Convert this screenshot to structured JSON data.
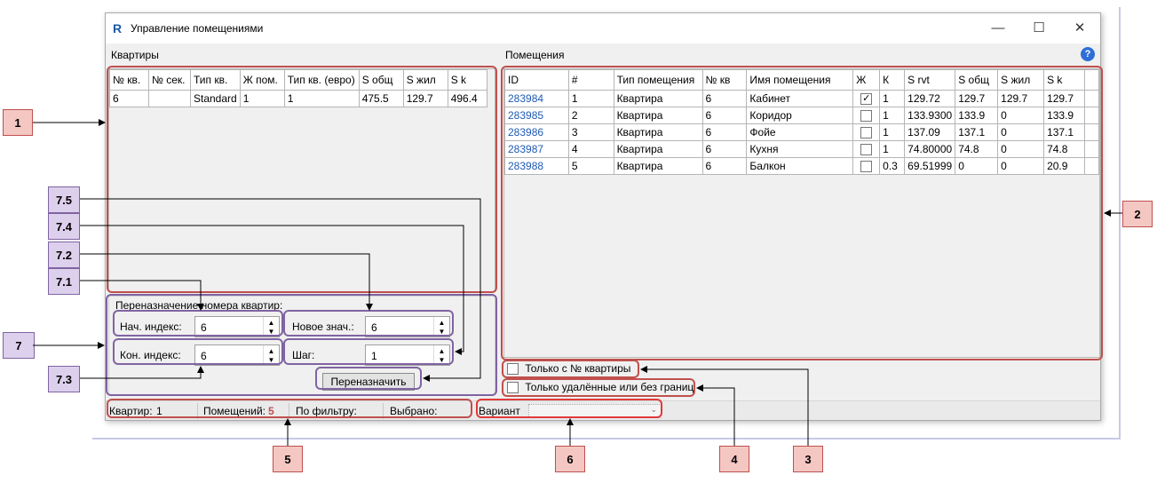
{
  "window": {
    "app_icon": "R",
    "title": "Управление помещениями",
    "controls": [
      "—",
      "☐",
      "✕"
    ]
  },
  "apartments": {
    "label": "Квартиры",
    "columns": [
      "№ кв.",
      "№ сек.",
      "Тип кв.",
      "Ж пом.",
      "Тип кв. (евро)",
      "S общ",
      "S жил",
      "S k"
    ],
    "rows": [
      [
        "6",
        "",
        "Standard",
        "1",
        "1",
        "475.5",
        "129.7",
        "496.4"
      ]
    ]
  },
  "rooms": {
    "label": "Помещения",
    "help_icon": "?",
    "columns": [
      "ID",
      "#",
      "Тип помещения",
      "№ кв",
      "Имя помещения",
      "Ж",
      "К",
      "S rvt",
      "S общ",
      "S жил",
      "S k"
    ],
    "rows": [
      {
        "id": "283984",
        "n": "1",
        "type": "Квартира",
        "apt": "6",
        "name": "Кабинет",
        "zh": true,
        "k": "1",
        "srvt": "129.72",
        "sobsh": "129.7",
        "szhil": "129.7",
        "sk": "129.7"
      },
      {
        "id": "283985",
        "n": "2",
        "type": "Квартира",
        "apt": "6",
        "name": "Коридор",
        "zh": false,
        "k": "1",
        "srvt": "133.9300",
        "sobsh": "133.9",
        "szhil": "0",
        "sk": "133.9"
      },
      {
        "id": "283986",
        "n": "3",
        "type": "Квартира",
        "apt": "6",
        "name": "Фойе",
        "zh": false,
        "k": "1",
        "srvt": "137.09",
        "sobsh": "137.1",
        "szhil": "0",
        "sk": "137.1"
      },
      {
        "id": "283987",
        "n": "4",
        "type": "Квартира",
        "apt": "6",
        "name": "Кухня",
        "zh": false,
        "k": "1",
        "srvt": "74.80000",
        "sobsh": "74.8",
        "szhil": "0",
        "sk": "74.8"
      },
      {
        "id": "283988",
        "n": "5",
        "type": "Квартира",
        "apt": "6",
        "name": "Балкон",
        "zh": false,
        "k": "0.3",
        "srvt": "69.51999",
        "sobsh": "0",
        "szhil": "0",
        "sk": "20.9"
      }
    ]
  },
  "reassign": {
    "title": "Переназначение номера квартир:",
    "start_label": "Нач. индекс:",
    "start_value": "6",
    "end_label": "Кон. индекс:",
    "end_value": "6",
    "new_label": "Новое знач.:",
    "new_value": "6",
    "step_label": "Шаг:",
    "step_value": "1",
    "button": "Переназначить"
  },
  "filters": {
    "only_with_number": "Только с № квартиры",
    "only_deleted": "Только удалённые или без границ"
  },
  "status": {
    "apartments_label": "Квартир:",
    "apartments_value": "1",
    "rooms_label": "Помещений:",
    "rooms_value": "5",
    "filter_label": "По фильтру:",
    "selected_label": "Выбрано:"
  },
  "variant": {
    "label": "Вариант",
    "value": ""
  },
  "callouts": {
    "c1": "1",
    "c2": "2",
    "c3": "3",
    "c4": "4",
    "c5": "5",
    "c6": "6",
    "c7": "7",
    "c71": "7.1",
    "c72": "7.2",
    "c73": "7.3",
    "c74": "7.4",
    "c75": "7.5"
  },
  "colors": {
    "callout_red": "#c0504d",
    "callout_purple": "#8064a2",
    "link_blue": "#1e5ab4"
  }
}
